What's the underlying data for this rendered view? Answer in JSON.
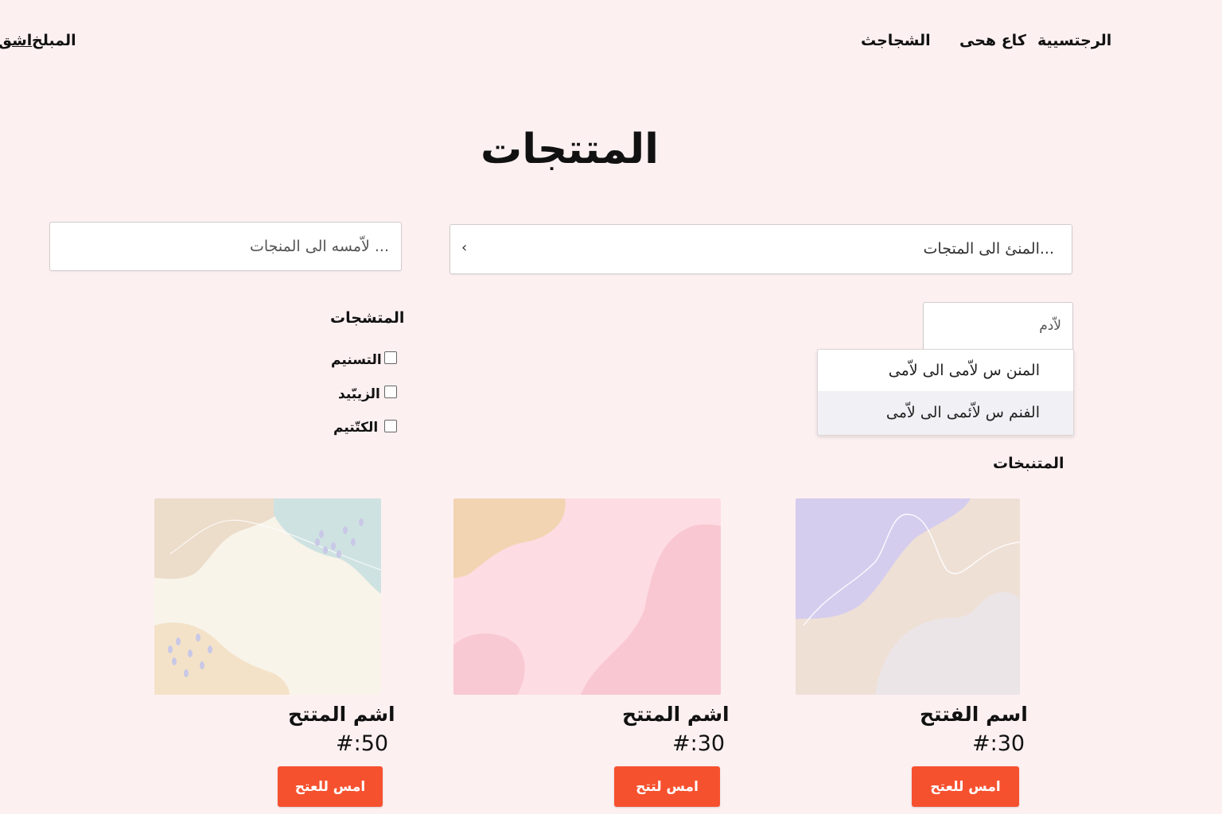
{
  "nav": {
    "right": [
      "الرجتسيية",
      "كاع هحى",
      "الشجاجث"
    ],
    "left": [
      "المبلخ",
      "اشق"
    ]
  },
  "page_title": "المتتجات",
  "search_main": {
    "value": "المنئ الى المتجات...",
    "arrow": "‹"
  },
  "search_secondary": {
    "placeholder": "لاّمسه الى المنجات ..."
  },
  "sort": {
    "input_value": "لاّدم",
    "options": [
      "المنن س لاّمى الى لاّمى",
      "الفنم س لاّئمى الى لاّمى"
    ],
    "selected_index": 1
  },
  "filters": {
    "heading": "المتشجات",
    "items": [
      {
        "label": "التسنيم",
        "checked": false
      },
      {
        "label": "الزيبّيد",
        "checked": false
      },
      {
        "label": "الكتّتيم",
        "checked": false
      }
    ]
  },
  "products_heading": "المتنبخات",
  "products": [
    {
      "name": "اسم الفتتح",
      "price": "#:30",
      "button": "امس للعتح"
    },
    {
      "name": "اشم المتتح",
      "price": "#:30",
      "button": "امس لتتح"
    },
    {
      "name": "اشم المتتح",
      "price": "#:50",
      "button": "امس للعتح"
    }
  ],
  "colors": {
    "background": "#fdf0f1",
    "accent": "#f6512f"
  }
}
